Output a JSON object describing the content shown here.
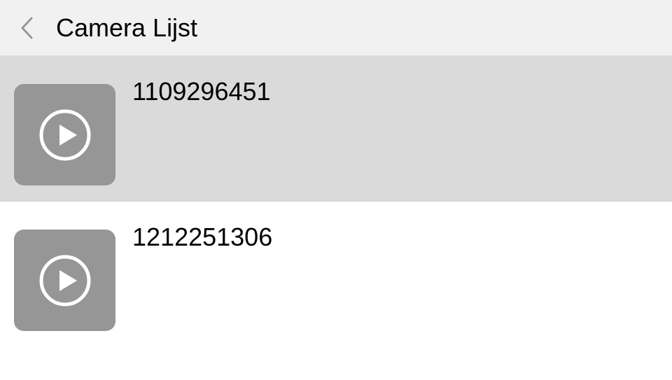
{
  "header": {
    "title": "Camera Lijst"
  },
  "list": {
    "items": [
      {
        "label": "1109296451",
        "selected": true
      },
      {
        "label": "1212251306",
        "selected": false
      }
    ]
  }
}
